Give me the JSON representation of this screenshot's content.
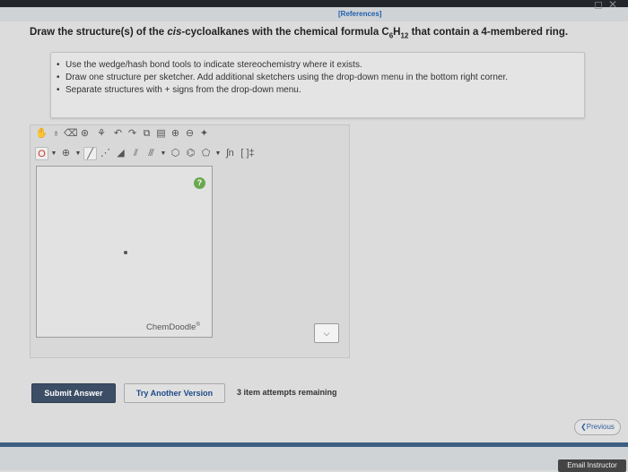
{
  "header": {
    "references_label": "[References]"
  },
  "question": {
    "prefix": "Draw the structure(s) of the ",
    "italic": "cis",
    "middle": "-cycloalkanes with the chemical formula C",
    "sub1": "6",
    "h": "H",
    "sub2": "12",
    "suffix": " that contain a 4-membered ring."
  },
  "instructions": {
    "items": [
      "Use the wedge/hash bond tools to indicate stereochemistry where it exists.",
      "Draw one structure per sketcher. Add additional sketchers using the drop-down menu in the bottom right corner.",
      "Separate structures with + signs from the drop-down menu."
    ]
  },
  "sketcher": {
    "toolbar1_icons": [
      "hand-icon",
      "lasso-icon",
      "eraser-icon",
      "ring-select-icon",
      "template-icon",
      "undo-icon",
      "redo-icon",
      "copy-icon",
      "paste-icon",
      "zoom-in-icon",
      "zoom-out-icon",
      "clean-icon"
    ],
    "atom_label": "O",
    "charge_symbol": "⊕",
    "text_label": "ʃn",
    "bracket_label": "[ ]‡",
    "watermark": "ChemDoodle",
    "help_glyph": "?",
    "multi_dropdown_glyph": "⌵"
  },
  "buttons": {
    "submit": "Submit Answer",
    "try_another": "Try Another Version"
  },
  "attempts_text": "3 item attempts remaining",
  "nav": {
    "previous": "Previous"
  },
  "footer": {
    "email_instructor": "Email Instructor"
  }
}
